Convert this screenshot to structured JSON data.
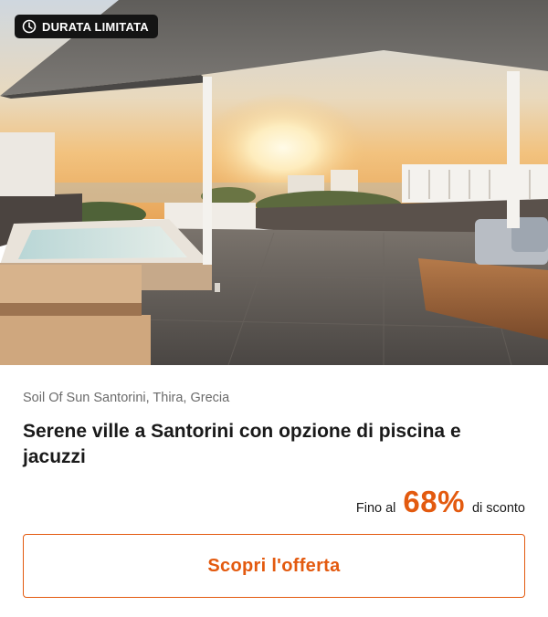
{
  "badge": {
    "label": "DURATA LIMITATA",
    "icon": "clock-icon"
  },
  "hero": {
    "image": "santorini-villa-terrace-photo"
  },
  "listing": {
    "location": "Soil Of Sun Santorini, Thira, Grecia",
    "title": "Serene ville a Santorini con opzione di piscina e jacuzzi"
  },
  "discount": {
    "prefix": "Fino al",
    "percent": "68%",
    "suffix": "di sconto"
  },
  "cta": {
    "label": "Scopri l'offerta"
  },
  "colors": {
    "accent": "#e35a0f",
    "badge_bg": "#141414",
    "text": "#1a1a1a",
    "muted": "#6b6b6b"
  }
}
